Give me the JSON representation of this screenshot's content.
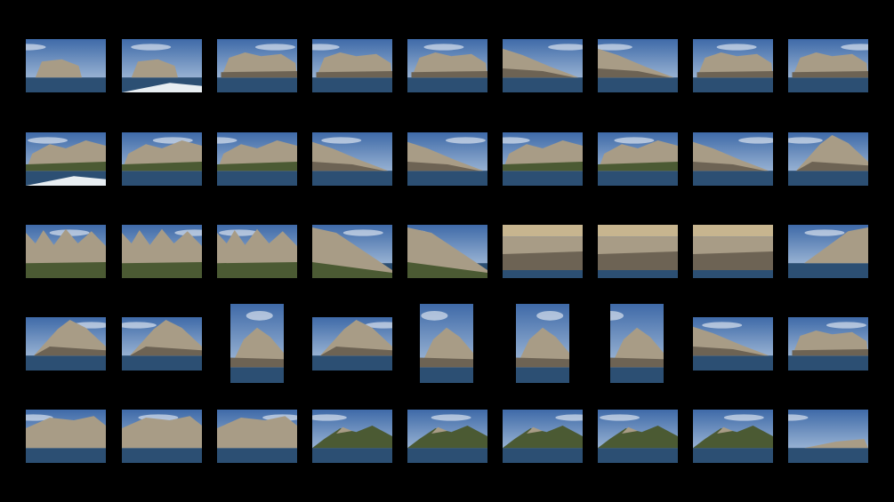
{
  "palette": {
    "background": "#000000",
    "sky_top": "#3f6aa8",
    "sky_bottom": "#b9cde3",
    "sea": "#2c4f73",
    "rock": "#a89c86",
    "rock_shadow": "#6d6354",
    "vegetation": "#4b5a33"
  },
  "thumbnails": [
    {
      "row": 0,
      "kind": "island-distant"
    },
    {
      "row": 0,
      "kind": "island-distant-boat"
    },
    {
      "row": 0,
      "kind": "island-ridge"
    },
    {
      "row": 0,
      "kind": "island-ridge"
    },
    {
      "row": 0,
      "kind": "island-ridge"
    },
    {
      "row": 0,
      "kind": "headland"
    },
    {
      "row": 0,
      "kind": "headland"
    },
    {
      "row": 0,
      "kind": "island-ridge"
    },
    {
      "row": 0,
      "kind": "island-ridge"
    },
    {
      "row": 1,
      "kind": "cliff-near-boat"
    },
    {
      "row": 1,
      "kind": "cliff-near"
    },
    {
      "row": 1,
      "kind": "cliff-near"
    },
    {
      "row": 1,
      "kind": "headland"
    },
    {
      "row": 1,
      "kind": "headland"
    },
    {
      "row": 1,
      "kind": "cliff-near"
    },
    {
      "row": 1,
      "kind": "cliff-near"
    },
    {
      "row": 1,
      "kind": "headland"
    },
    {
      "row": 1,
      "kind": "peak"
    },
    {
      "row": 2,
      "kind": "pinnacles"
    },
    {
      "row": 2,
      "kind": "pinnacles"
    },
    {
      "row": 2,
      "kind": "pinnacles"
    },
    {
      "row": 2,
      "kind": "slope"
    },
    {
      "row": 2,
      "kind": "slope"
    },
    {
      "row": 2,
      "kind": "wall"
    },
    {
      "row": 2,
      "kind": "wall"
    },
    {
      "row": 2,
      "kind": "wall"
    },
    {
      "row": 2,
      "kind": "headland-right"
    },
    {
      "row": 3,
      "kind": "peak"
    },
    {
      "row": 3,
      "kind": "peak"
    },
    {
      "row": 3,
      "kind": "peak-tall"
    },
    {
      "row": 3,
      "kind": "peak"
    },
    {
      "row": 3,
      "kind": "peak-tall"
    },
    {
      "row": 3,
      "kind": "peak-tall"
    },
    {
      "row": 3,
      "kind": "peak-tall"
    },
    {
      "row": 3,
      "kind": "headland"
    },
    {
      "row": 3,
      "kind": "island-ridge"
    },
    {
      "row": 4,
      "kind": "massif"
    },
    {
      "row": 4,
      "kind": "massif"
    },
    {
      "row": 4,
      "kind": "massif"
    },
    {
      "row": 4,
      "kind": "range-distant"
    },
    {
      "row": 4,
      "kind": "range-distant"
    },
    {
      "row": 4,
      "kind": "range-distant"
    },
    {
      "row": 4,
      "kind": "range-distant"
    },
    {
      "row": 4,
      "kind": "range-distant"
    },
    {
      "row": 4,
      "kind": "island-low"
    }
  ]
}
